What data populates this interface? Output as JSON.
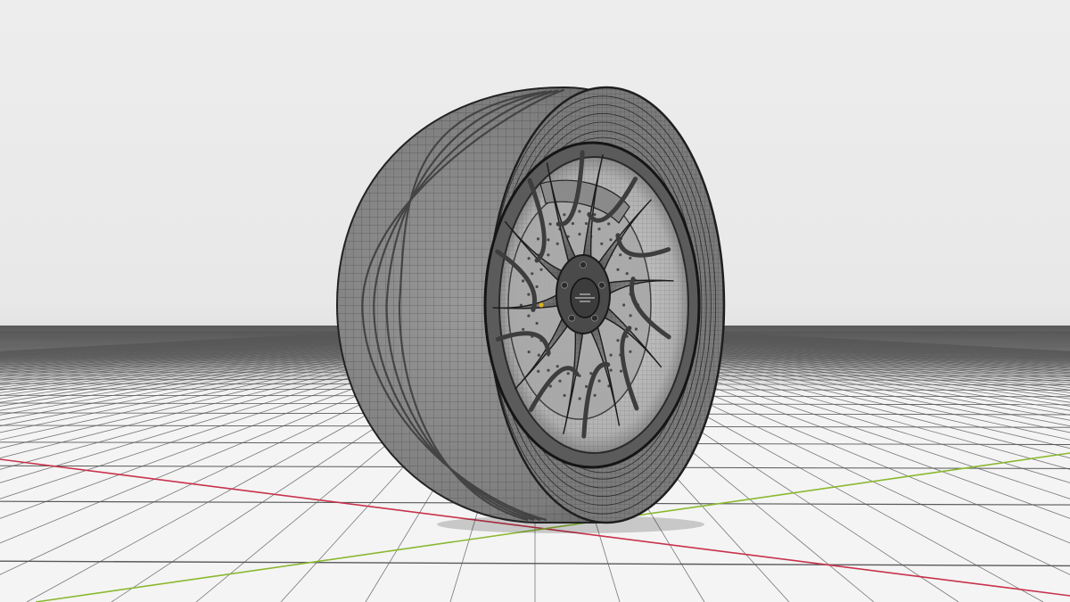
{
  "scene": {
    "subject": "wheel-and-tire-model",
    "display_mode": "wireframe-on-shaded",
    "spoke_count": 10,
    "colors": {
      "background": "#ebebeb",
      "floor": "#f4f4f4",
      "grid_line": "#585858",
      "x_axis": "#c8324c",
      "y_axis": "#8ab830",
      "model_shade": "#7a7a7a",
      "wire": "#2e2e2e",
      "accent": "#e0b020"
    }
  }
}
